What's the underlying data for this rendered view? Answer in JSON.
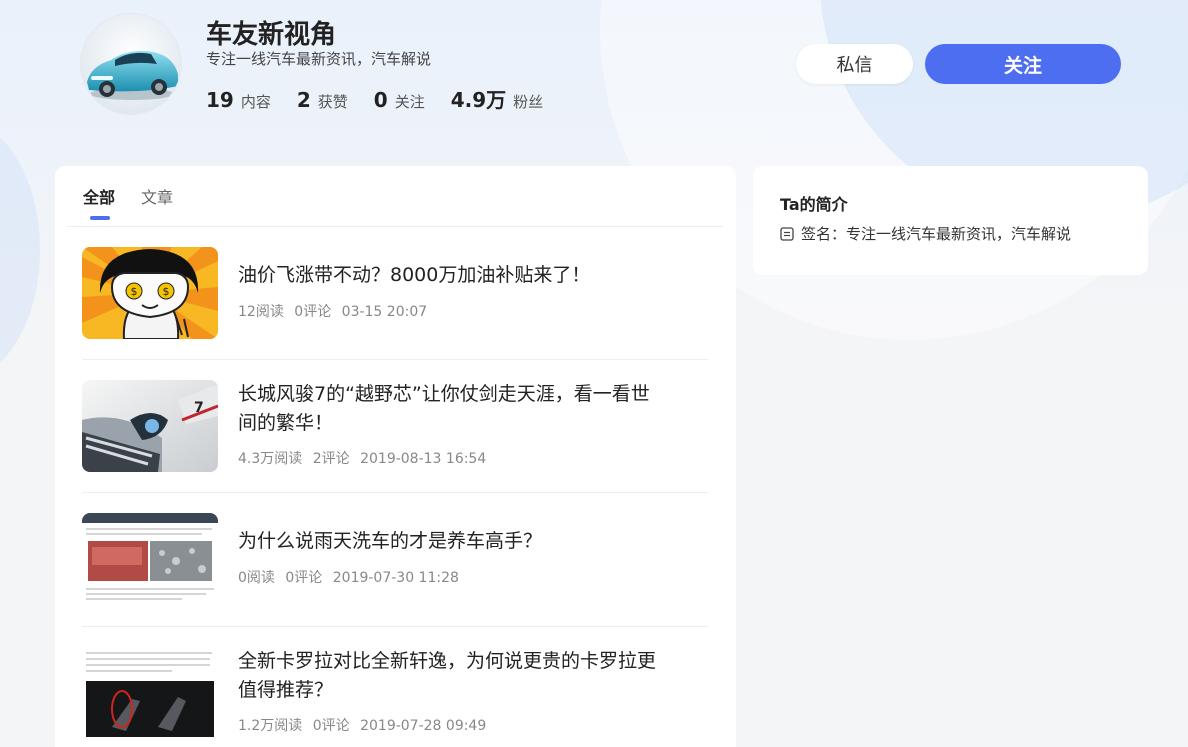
{
  "profile": {
    "name": "车友新视角",
    "signature": "专注一线汽车最新资讯，汽车解说",
    "stats": [
      {
        "value": "19",
        "label": "内容"
      },
      {
        "value": "2",
        "label": "获赞"
      },
      {
        "value": "0",
        "label": "关注"
      },
      {
        "value": "4.9万",
        "label": "粉丝"
      }
    ]
  },
  "actions": {
    "message_label": "私信",
    "follow_label": "关注"
  },
  "tabs": [
    {
      "label": "全部",
      "active": true
    },
    {
      "label": "文章",
      "active": false
    }
  ],
  "articles": [
    {
      "title": "油价飞涨带不动？8000万加油补贴来了！",
      "reads": "12阅读",
      "comments": "0评论",
      "time": "03-15 20:07"
    },
    {
      "title": "长城风骏7的“越野芯”让你仗剑走天涯，看一看世间的繁华！",
      "reads": "4.3万阅读",
      "comments": "2评论",
      "time": "2019-08-13 16:54"
    },
    {
      "title": "为什么说雨天洗车的才是养车高手？",
      "reads": "0阅读",
      "comments": "0评论",
      "time": "2019-07-30 11:28"
    },
    {
      "title": "全新卡罗拉对比全新轩逸，为何说更贵的卡罗拉更值得推荐？",
      "reads": "1.2万阅读",
      "comments": "0评论",
      "time": "2019-07-28 09:49"
    }
  ],
  "sidebar": {
    "title": "Ta的简介",
    "signature_line": "签名：专注一线汽车最新资讯，汽车解说",
    "icon": "document-icon"
  },
  "colors": {
    "accent": "#4e6ef2",
    "background": "#f4f5f7",
    "card": "#ffffff"
  }
}
